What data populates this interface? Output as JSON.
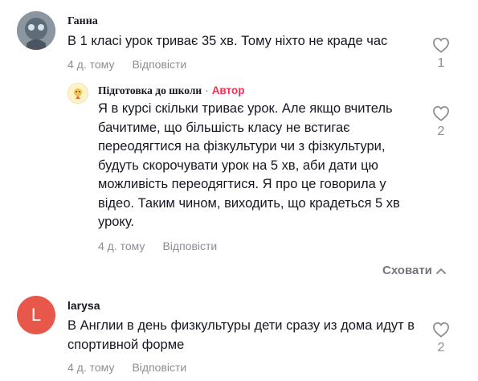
{
  "comments": [
    {
      "author": "Ганна",
      "text": "В 1 класі урок триває 35 хв. Тому ніхто не краде час",
      "time": "4 д. тому",
      "reply_label": "Відповісти",
      "likes": "1"
    }
  ],
  "reply": {
    "author": "Підготовка до школи",
    "badge_sep": "·",
    "badge": "Автор",
    "text": "Я в курсі скільки триває урок. Але якщо вчитель бачитиме, що більшість класу не встигає переодягтися на фізкультури чи з фізкультури, будуть скорочувати урок на 5 хв, аби дати цю можливість переодягтися. Я про це говорила у відео. Таким чином, виходить, що крадеться 5 хв уроку.",
    "time": "4 д. тому",
    "reply_label": "Відповісти",
    "likes": "2"
  },
  "hide_label": "Сховати",
  "comment2": {
    "avatar_letter": "L",
    "author": "larysa",
    "text": "В Англии в день физкультуры дети сразу из дома идут в спортивной форме",
    "time": "4 д. тому",
    "reply_label": "Відповісти",
    "likes": "2"
  },
  "colors": {
    "author_badge": "#fe2c55",
    "avatar_l": "#e8584a",
    "muted": "#8a8b91"
  },
  "icons": [
    "heart-icon",
    "chevron-up-icon"
  ]
}
